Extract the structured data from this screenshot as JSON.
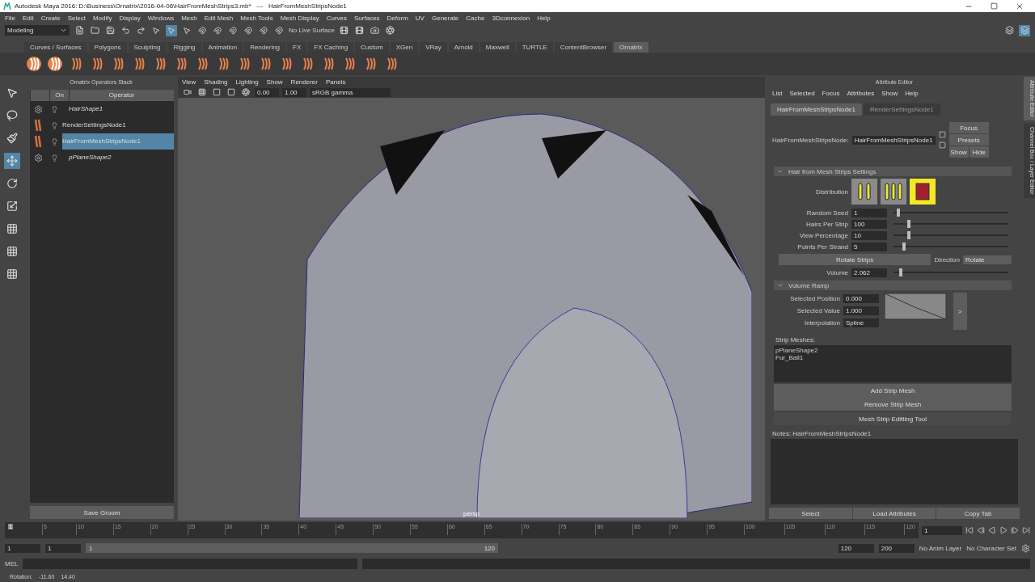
{
  "window": {
    "title": "Autodesk Maya 2016: D:\\Business\\Ornatrix\\2016-04-06\\HairFromMeshStrips3.mb*   ---   HairFromMeshStripsNode1"
  },
  "menu": [
    "File",
    "Edit",
    "Create",
    "Select",
    "Modify",
    "Display",
    "Windows",
    "Mesh",
    "Edit Mesh",
    "Mesh Tools",
    "Mesh Display",
    "Curves",
    "Surfaces",
    "Deform",
    "UV",
    "Generate",
    "Cache",
    "3Dconnexion",
    "Help"
  ],
  "toolbar": {
    "mode": "Modeling",
    "live_surface": "No Live Surface",
    "select_tools": [
      {
        "selected": false
      },
      {
        "selected": true
      },
      {
        "selected": false
      }
    ]
  },
  "shelf_tabs": [
    {
      "label": "Curves / Surfaces",
      "selected": false
    },
    {
      "label": "Polygons",
      "selected": false
    },
    {
      "label": "Sculpting",
      "selected": false
    },
    {
      "label": "Rigging",
      "selected": false
    },
    {
      "label": "Animation",
      "selected": false
    },
    {
      "label": "Rendering",
      "selected": false
    },
    {
      "label": "FX",
      "selected": false
    },
    {
      "label": "FX Caching",
      "selected": false
    },
    {
      "label": "Custom",
      "selected": false
    },
    {
      "label": "XGen",
      "selected": false
    },
    {
      "label": "VRay",
      "selected": false
    },
    {
      "label": "Arnold",
      "selected": false
    },
    {
      "label": "Maxwell",
      "selected": false
    },
    {
      "label": "TURTLE",
      "selected": false
    },
    {
      "label": "ContentBrowser",
      "selected": false
    },
    {
      "label": "Ornatrix",
      "selected": true
    }
  ],
  "operator_stack": {
    "title": "Ornatrix Operators Stack",
    "columns": [
      "On",
      "Operator"
    ],
    "rows": [
      {
        "name": "HairShape1",
        "kind": "shape",
        "selected": false
      },
      {
        "name": "RenderSettingsNode1",
        "kind": "operator",
        "selected": false
      },
      {
        "name": "HairFromMeshStripsNode1",
        "kind": "operator",
        "selected": true
      },
      {
        "name": "pPlaneShape2",
        "kind": "shape",
        "selected": false
      }
    ],
    "save_button": "Save Groom"
  },
  "viewport": {
    "menu": [
      "View",
      "Shading",
      "Lighting",
      "Show",
      "Renderer",
      "Panels"
    ],
    "exposure": "0.00",
    "gamma": "1.00",
    "color_space": "sRGB gamma",
    "camera": "persp"
  },
  "attribute_editor": {
    "title": "Attribute Editor",
    "menu": [
      "List",
      "Selected",
      "Focus",
      "Attributes",
      "Show",
      "Help"
    ],
    "tabs": [
      {
        "label": "HairFromMeshStripsNode1",
        "selected": true
      },
      {
        "label": "RenderSettingsNode1",
        "selected": false
      }
    ],
    "node_label": "HairFromMeshStripsNode:",
    "node_value": "HairFromMeshStripsNode1",
    "side_buttons": [
      "Focus",
      "Presets",
      "Show",
      "Hide"
    ],
    "section": "Hair from Mesh Strips Settings",
    "distribution_label": "Distribution",
    "distribution": [
      {
        "kind": "two",
        "selected": false
      },
      {
        "kind": "three",
        "selected": false
      },
      {
        "kind": "fill",
        "selected": true
      }
    ],
    "sliders": [
      {
        "label": "Random Seed",
        "value": "1",
        "level": 0.03
      },
      {
        "label": "Hairs Per Strip",
        "value": "100",
        "level": 0.12
      },
      {
        "label": "View Percentage",
        "value": "10",
        "level": 0.12
      },
      {
        "label": "Points Per Strand",
        "value": "5",
        "level": 0.08
      }
    ],
    "rotate_button": "Rotate Strips",
    "direction_label": "Direction",
    "direction_value": "Rotate",
    "volume": {
      "label": "Volume",
      "value": "2.062",
      "level": 0.05
    },
    "ramp": {
      "title": "Volume Ramp",
      "fields": [
        {
          "label": "Selected Position",
          "value": "0.000"
        },
        {
          "label": "Selected Value",
          "value": "1.000"
        }
      ],
      "interpolation_label": "Interpolation",
      "interpolation_value": "Spline",
      "expand": ">"
    },
    "strip_meshes_label": "Strip Meshes:",
    "strip_meshes": [
      "pPlaneShape2",
      "Fur_Ball1"
    ],
    "strip_buttons": [
      "Add Strip Mesh",
      "Remove Strip Mesh"
    ],
    "tool_button": "Mesh Strip Editting Tool",
    "notes_label": "Notes:  HairFromMeshStripsNode1",
    "bottom_buttons": [
      "Select",
      "Load Attributes",
      "Copy Tab"
    ],
    "side_tabs": [
      "Attribute Editor",
      "Channel Box / Layer Editor"
    ]
  },
  "timeline": {
    "ticks": [
      "1",
      "5",
      "10",
      "15",
      "20",
      "25",
      "30",
      "35",
      "40",
      "45",
      "50",
      "55",
      "60",
      "65",
      "70",
      "75",
      "80",
      "85",
      "90",
      "95",
      "100",
      "105",
      "110",
      "115",
      "120"
    ],
    "current_frame": "1",
    "level": 0
  },
  "range": {
    "start": "1",
    "playback_start": "1",
    "slider_start": "1",
    "slider_end": "120",
    "level": 1,
    "playback_end": "120",
    "end": "200",
    "anim_layer": "No Anim Layer",
    "character_set": "No Character Set"
  },
  "command_line": {
    "label": "MEL"
  },
  "help_line": [
    "Rotation:",
    "-11.60",
    "14.40"
  ]
}
